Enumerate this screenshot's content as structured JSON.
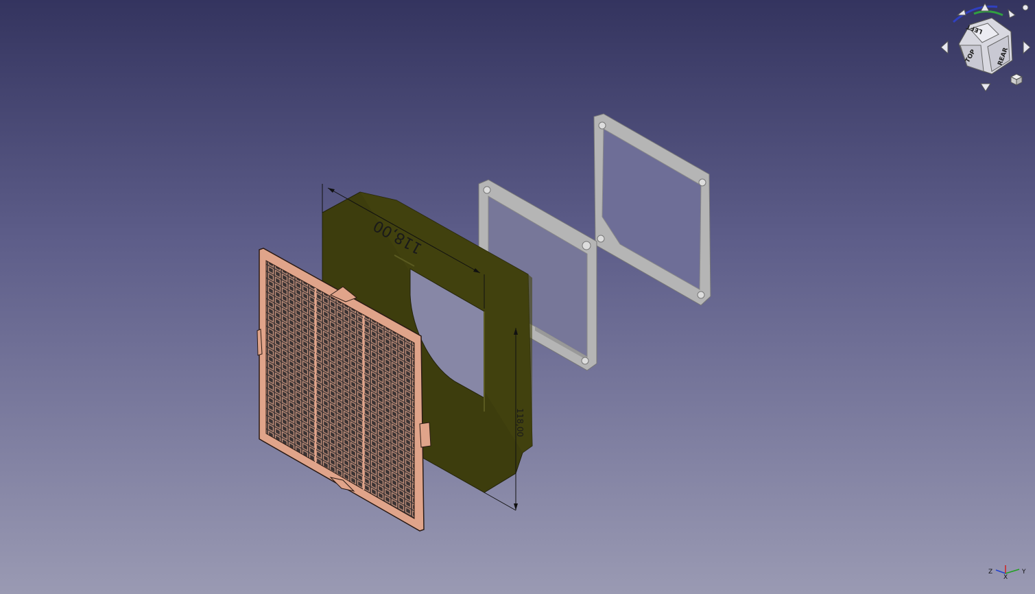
{
  "viewport": {
    "dimensions": [
      {
        "value": "118,00",
        "orientation": "top"
      },
      {
        "value": "118,00",
        "orientation": "right"
      }
    ]
  },
  "navcube": {
    "faces": {
      "top": "TOP",
      "rear": "REAR",
      "left": "LEFT"
    }
  },
  "axis_cross": {
    "labels": {
      "z": "Z",
      "x": "X",
      "y": "Y"
    },
    "colors": {
      "x": "#d02020",
      "y": "#20a020",
      "z": "#2040d0"
    }
  },
  "colors": {
    "grille": "#e0a48a",
    "adapter_plate": "#3c3c0c",
    "fan_frame": "#b8b8b8"
  }
}
